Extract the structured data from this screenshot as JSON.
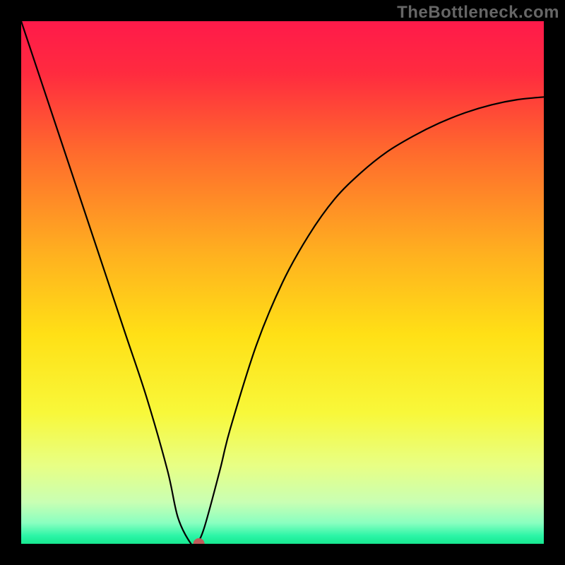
{
  "watermark": "TheBottleneck.com",
  "chart_data": {
    "type": "line",
    "title": "",
    "xlabel": "",
    "ylabel": "",
    "xlim": [
      0,
      1
    ],
    "ylim": [
      0,
      100
    ],
    "background_gradient": {
      "stops": [
        {
          "offset": 0.0,
          "color": "#ff1a4a"
        },
        {
          "offset": 0.1,
          "color": "#ff2b3f"
        },
        {
          "offset": 0.25,
          "color": "#ff6a2d"
        },
        {
          "offset": 0.45,
          "color": "#ffb21f"
        },
        {
          "offset": 0.6,
          "color": "#ffe016"
        },
        {
          "offset": 0.75,
          "color": "#f8f83a"
        },
        {
          "offset": 0.85,
          "color": "#e8ff84"
        },
        {
          "offset": 0.92,
          "color": "#c9ffb3"
        },
        {
          "offset": 0.96,
          "color": "#8affc0"
        },
        {
          "offset": 0.985,
          "color": "#2bf5a6"
        },
        {
          "offset": 1.0,
          "color": "#17e890"
        }
      ]
    },
    "series": [
      {
        "name": "bottleneck-curve",
        "color": "#000000",
        "x": [
          0.0,
          0.04,
          0.08,
          0.12,
          0.16,
          0.2,
          0.24,
          0.28,
          0.3,
          0.325,
          0.335,
          0.35,
          0.38,
          0.4,
          0.45,
          0.5,
          0.55,
          0.6,
          0.65,
          0.7,
          0.75,
          0.8,
          0.85,
          0.9,
          0.95,
          1.0
        ],
        "y": [
          100,
          88,
          76,
          64,
          52,
          40,
          28,
          14,
          5,
          0,
          0,
          3,
          14,
          22,
          38,
          50,
          59,
          66,
          71,
          75,
          78,
          80.5,
          82.5,
          84,
          85,
          85.5
        ]
      }
    ],
    "marker": {
      "x": 0.34,
      "y": 0,
      "color": "#c05a5a",
      "radius": 8
    }
  }
}
